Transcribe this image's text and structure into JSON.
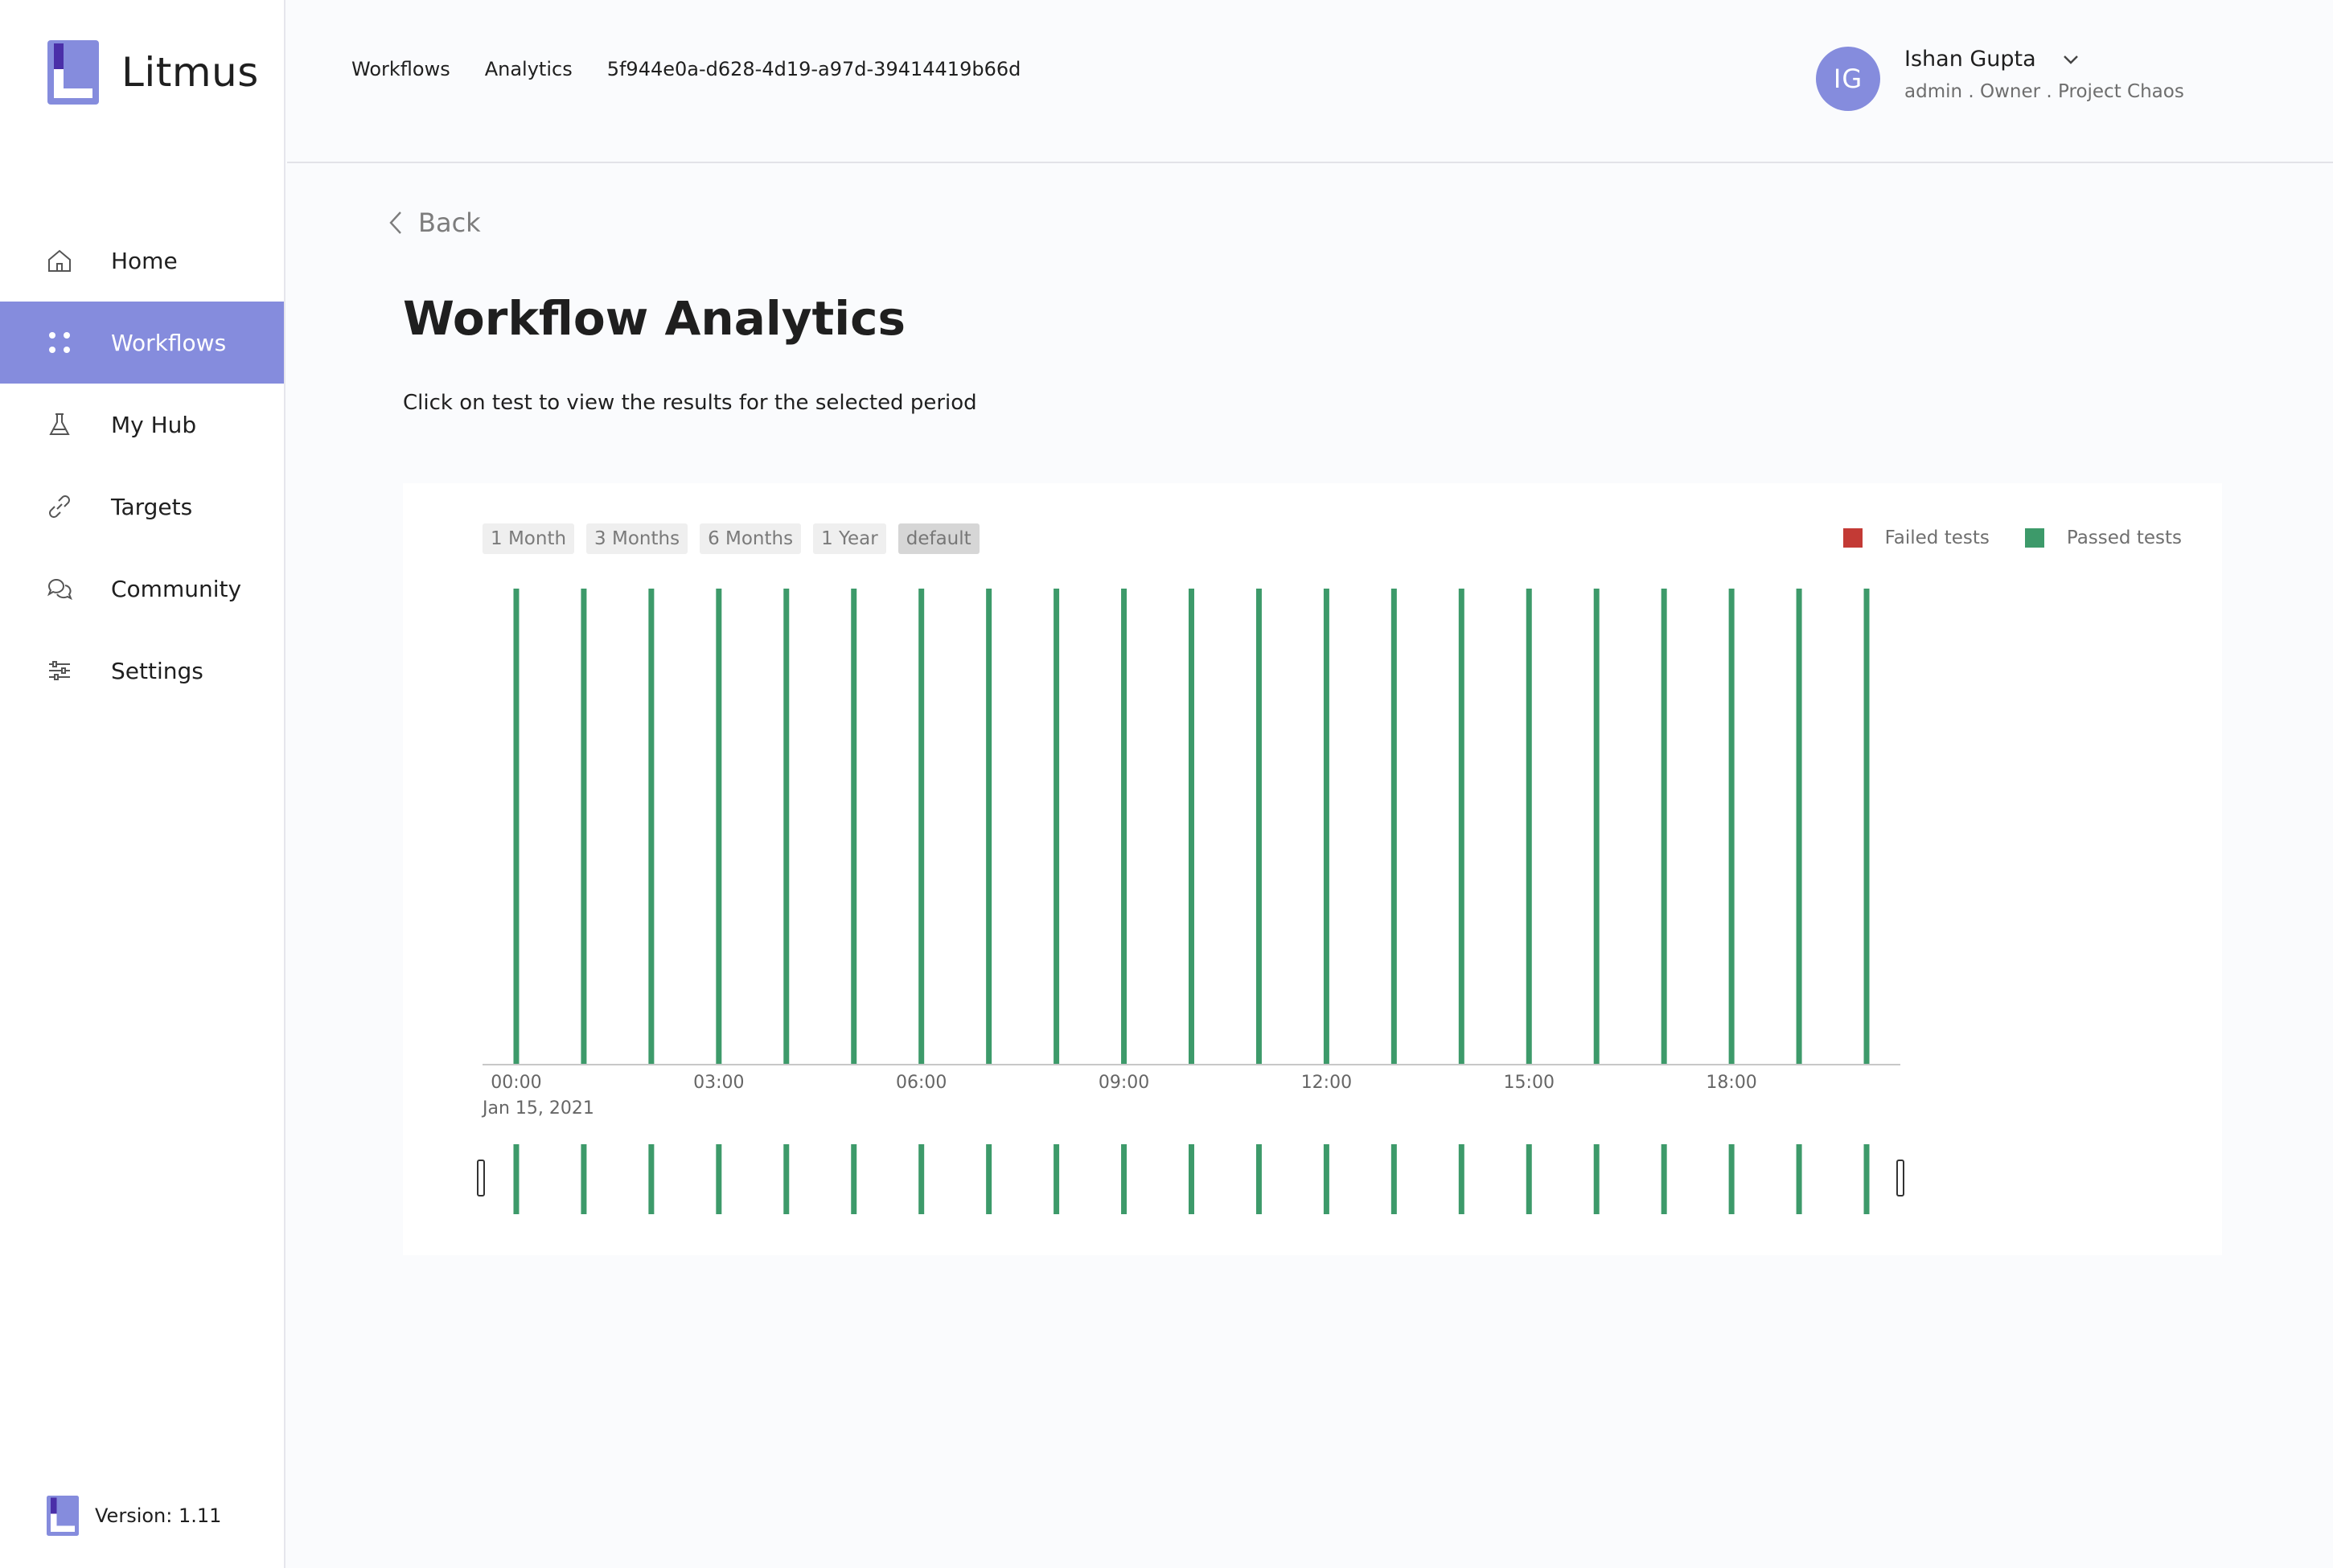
{
  "sidebar": {
    "brand": "Litmus",
    "items": [
      {
        "label": "Home",
        "icon": "home-icon",
        "active": false
      },
      {
        "label": "Workflows",
        "icon": "workflows-icon",
        "active": true
      },
      {
        "label": "My Hub",
        "icon": "flask-icon",
        "active": false
      },
      {
        "label": "Targets",
        "icon": "link-icon",
        "active": false
      },
      {
        "label": "Community",
        "icon": "chat-icon",
        "active": false
      },
      {
        "label": "Settings",
        "icon": "sliders-icon",
        "active": false
      }
    ],
    "version": "Version: 1.11"
  },
  "header": {
    "breadcrumb": [
      "Workflows",
      "Analytics",
      "5f944e0a-d628-4d19-a97d-39414419b66d"
    ],
    "user": {
      "initials": "IG",
      "name": "Ishan Gupta",
      "role": "admin . Owner . Project Chaos"
    }
  },
  "main": {
    "back_label": "Back",
    "title": "Workflow Analytics",
    "subtitle": "Click on test to view the results for the selected period"
  },
  "chart": {
    "range_buttons": [
      "1 Month",
      "3 Months",
      "6 Months",
      "1 Year",
      "default"
    ],
    "active_range": "default",
    "legend": [
      {
        "label": "Failed tests",
        "color": "#c33a35"
      },
      {
        "label": "Passed tests",
        "color": "#3d9a6a"
      }
    ]
  },
  "chart_data": {
    "type": "bar",
    "x_axis": "time",
    "date_label": "Jan 15, 2021",
    "tick_labels": [
      "00:00",
      "03:00",
      "06:00",
      "09:00",
      "12:00",
      "15:00",
      "18:00"
    ],
    "tick_hours": [
      0,
      3,
      6,
      9,
      12,
      15,
      18
    ],
    "series": [
      {
        "name": "Passed tests",
        "color": "#3d9a6a",
        "x_hours": [
          0,
          1,
          2,
          3,
          4,
          5,
          6,
          7,
          8,
          9,
          10,
          11,
          12,
          13,
          14,
          15,
          16,
          17,
          18,
          19,
          20
        ],
        "values": [
          1,
          1,
          1,
          1,
          1,
          1,
          1,
          1,
          1,
          1,
          1,
          1,
          1,
          1,
          1,
          1,
          1,
          1,
          1,
          1,
          1
        ]
      },
      {
        "name": "Failed tests",
        "color": "#c33a35",
        "x_hours": [],
        "values": []
      }
    ],
    "xlim_hours": [
      -0.5,
      20.5
    ],
    "ylim": [
      0,
      1
    ],
    "grid": false,
    "legend_position": "top-right"
  }
}
